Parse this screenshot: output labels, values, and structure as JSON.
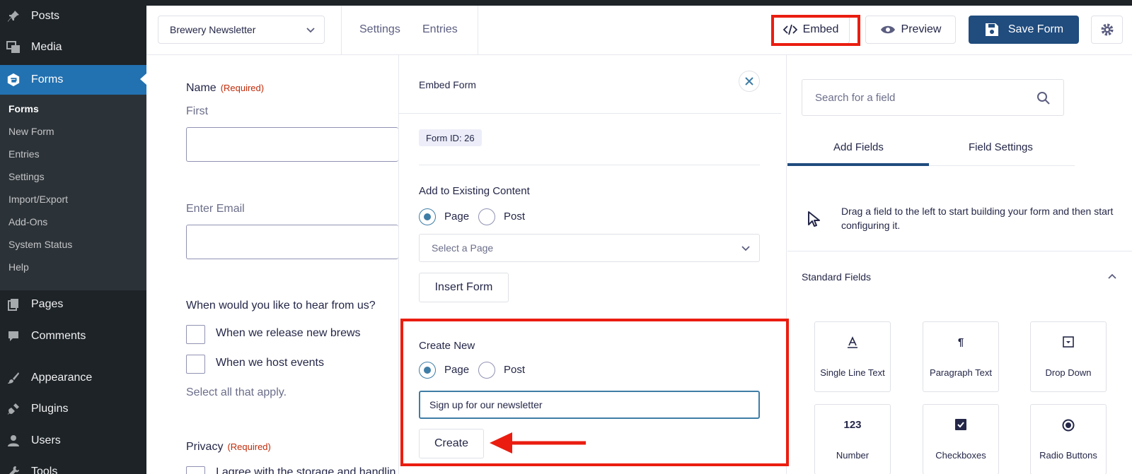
{
  "wp_menu": {
    "posts": "Posts",
    "media": "Media",
    "forms": "Forms",
    "pages": "Pages",
    "comments": "Comments",
    "appearance": "Appearance",
    "plugins": "Plugins",
    "users": "Users",
    "tools": "Tools",
    "forms_submenu": [
      "Forms",
      "New Form",
      "Entries",
      "Settings",
      "Import/Export",
      "Add-Ons",
      "System Status",
      "Help"
    ]
  },
  "toolbar": {
    "form_name": "Brewery Newsletter",
    "settings_link": "Settings",
    "entries_link": "Entries",
    "embed_label": "Embed",
    "preview_label": "Preview",
    "save_label": "Save Form"
  },
  "form_canvas": {
    "name_label": "Name",
    "required": "(Required)",
    "first_sublabel": "First",
    "email_label": "Enter Email",
    "hear_label": "When would you like to hear from us?",
    "option1": "When we release new brews",
    "option2": "When we host events",
    "description": "Select all that apply.",
    "privacy_label": "Privacy",
    "privacy_text": "I agree with the storage and handlin"
  },
  "embed_panel": {
    "title": "Embed Form",
    "form_id": "Form ID: 26",
    "existing_title": "Add to Existing Content",
    "page_label": "Page",
    "post_label": "Post",
    "select_placeholder": "Select a Page",
    "insert_button": "Insert Form",
    "create_title": "Create New",
    "create_input_value": "Sign up for our newsletter",
    "create_button": "Create"
  },
  "right_panel": {
    "search_placeholder": "Search for a field",
    "tab_add": "Add Fields",
    "tab_settings": "Field Settings",
    "hint": "Drag a field to the left to start building your form and then start configuring it.",
    "section_title": "Standard Fields",
    "fields": [
      {
        "label": "Single Line Text",
        "icon": "A"
      },
      {
        "label": "Paragraph Text",
        "icon": "¶"
      },
      {
        "label": "Drop Down",
        "icon": "▾"
      },
      {
        "label": "Number",
        "icon": "123"
      },
      {
        "label": "Checkboxes",
        "icon": "☑"
      },
      {
        "label": "Radio Buttons",
        "icon": "◉"
      }
    ]
  },
  "colors": {
    "wp_sidebar": "#1d2327",
    "wp_active": "#2271b1",
    "save_button": "#204c7e",
    "highlight_red": "#ea1d10",
    "required_red": "#c02b0a"
  }
}
